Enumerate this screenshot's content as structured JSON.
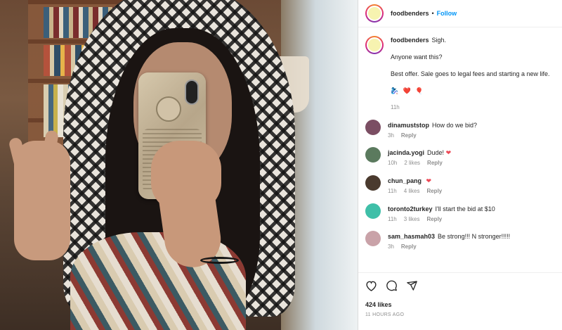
{
  "post": {
    "username": "foodbenders",
    "follow_label": "Follow",
    "caption_lines": [
      "Sigh.",
      "Anyone want this?",
      "Best offer. Sale goes to legal fees and starting a new life."
    ],
    "caption_emojis": "🧞‍♀️ ❤️ 🎈",
    "caption_time": "11h"
  },
  "comments": [
    {
      "user": "dinamuststop",
      "text": "How do we bid?",
      "heart": "",
      "time": "3h",
      "likes": "",
      "reply": "Reply",
      "avatar_color": "#7b4e63"
    },
    {
      "user": "jacinda.yogi",
      "text": "Dude!",
      "heart": "❤",
      "time": "10h",
      "likes": "2 likes",
      "reply": "Reply",
      "avatar_color": "#5b7a5e"
    },
    {
      "user": "chun_pang",
      "text": "",
      "heart": "❤",
      "time": "11h",
      "likes": "4 likes",
      "reply": "Reply",
      "avatar_color": "#4a3a2e"
    },
    {
      "user": "toronto2turkey",
      "text": "I'll start the bid at $10",
      "heart": "",
      "time": "11h",
      "likes": "3 likes",
      "reply": "Reply",
      "avatar_color": "#3fbfa8"
    },
    {
      "user": "sam_hasmah03",
      "text": "Be strong!!! N stronger!!!!!",
      "heart": "",
      "time": "3h",
      "likes": "",
      "reply": "Reply",
      "avatar_color": "#c9a2a8"
    }
  ],
  "footer": {
    "likes": "424 likes",
    "ago": "11 HOURS AGO"
  },
  "icons": {
    "like": "heart-icon",
    "comment": "comment-icon",
    "share": "share-icon"
  }
}
